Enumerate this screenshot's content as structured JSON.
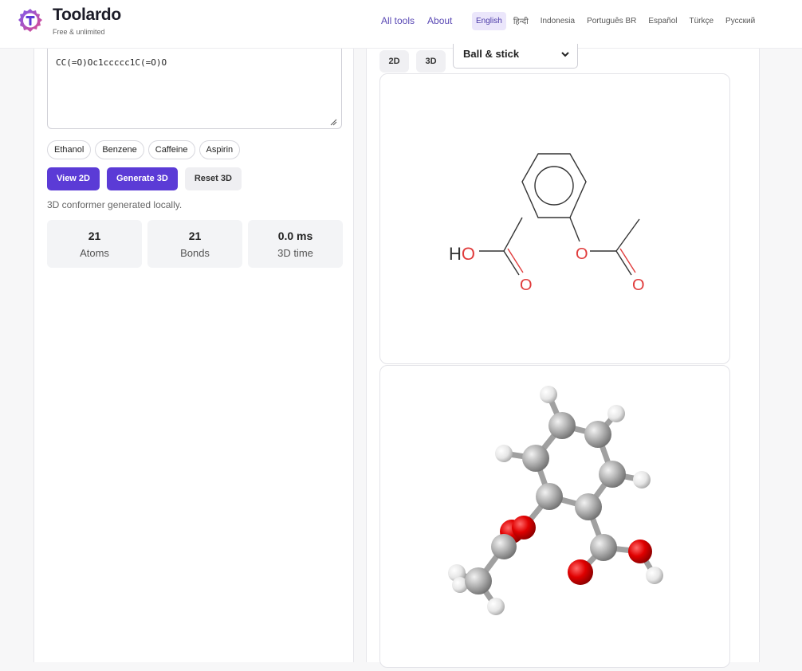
{
  "brand": {
    "name": "Toolardo",
    "tagline": "Free & unlimited",
    "accent": "#5b3bd6"
  },
  "nav": {
    "all_tools": "All tools",
    "about": "About"
  },
  "languages": [
    "English",
    "हिन्दी",
    "Indonesia",
    "Português BR",
    "Español",
    "Türkçe",
    "Русский"
  ],
  "active_language": "English",
  "editor": {
    "smiles_value": "CC(=O)Oc1ccccc1C(=O)O"
  },
  "examples": [
    "Ethanol",
    "Benzene",
    "Caffeine",
    "Aspirin"
  ],
  "actions": {
    "view2d": "View 2D",
    "generate3d": "Generate 3D",
    "reset3d": "Reset 3D"
  },
  "status": "3D conformer generated locally.",
  "stats": [
    {
      "value": "21",
      "label": "Atoms"
    },
    {
      "value": "21",
      "label": "Bonds"
    },
    {
      "value": "0.0 ms",
      "label": "3D time"
    }
  ],
  "viewer": {
    "tab_2d": "2D",
    "tab_3d": "3D",
    "style": "Ball & stick"
  },
  "molecule2d": {
    "hydroxyl_label": "HO",
    "oxygen_label": "O",
    "carbonyl_label": "O",
    "ester_o_label": "O",
    "ester_carbonyl_label": "O"
  },
  "colors": {
    "oxygen": "#e03b3b",
    "carbon3d": "#a7a7a7",
    "oxygen3d": "#e00000",
    "hydrogen3d": "#e8e8e8"
  }
}
